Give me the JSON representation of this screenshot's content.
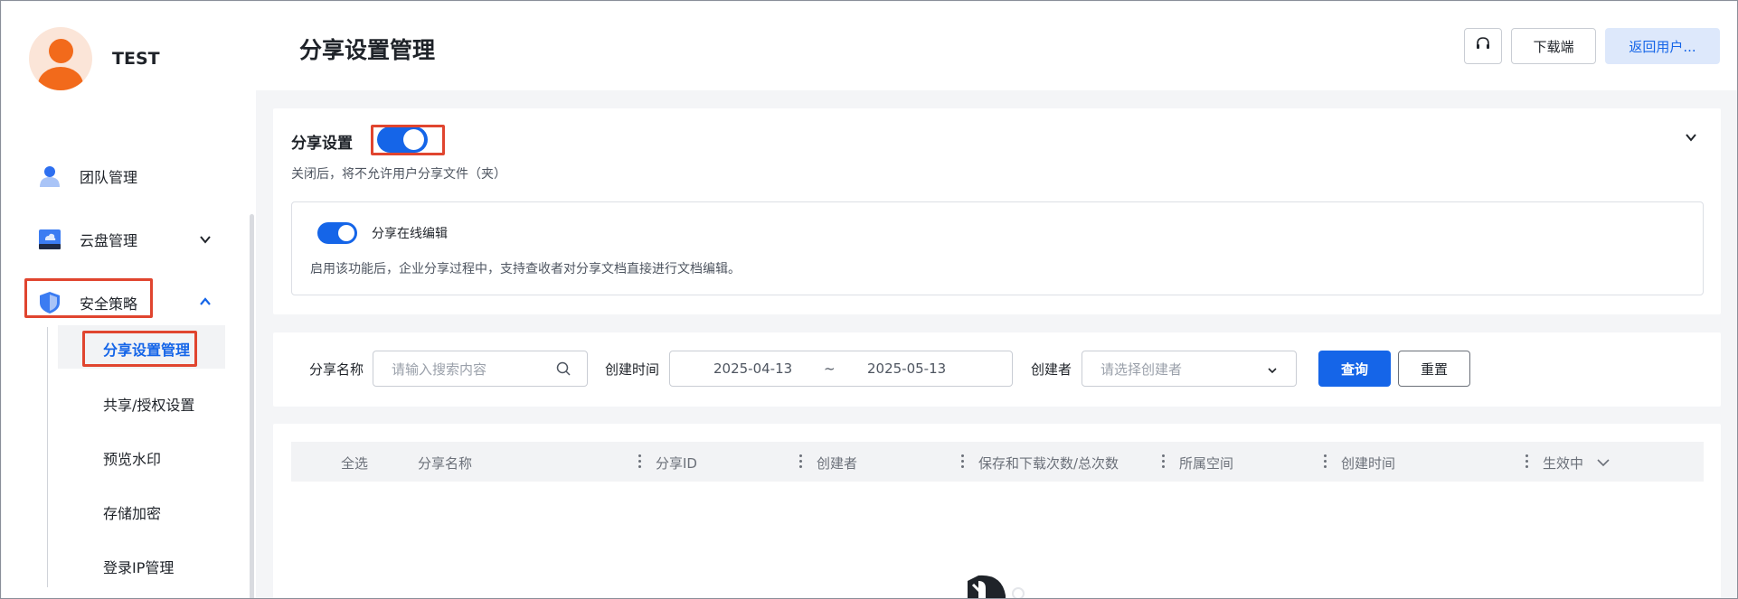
{
  "user": {
    "name": "TEST"
  },
  "sidebar": {
    "items": [
      {
        "label": "团队管理",
        "icon": "team-icon"
      },
      {
        "label": "云盘管理",
        "icon": "cloud-drive-icon",
        "expanded": false
      },
      {
        "label": "安全策略",
        "icon": "shield-icon",
        "expanded": true
      }
    ],
    "sub_items": [
      {
        "label": "分享设置管理",
        "active": true
      },
      {
        "label": "共享/授权设置",
        "active": false
      },
      {
        "label": "预览水印",
        "active": false
      },
      {
        "label": "存储加密",
        "active": false
      },
      {
        "label": "登录IP管理",
        "active": false
      }
    ]
  },
  "header": {
    "title": "分享设置管理",
    "support_icon": "headset-icon",
    "download_label": "下载端",
    "return_label": "返回用户..."
  },
  "share_settings": {
    "title": "分享设置",
    "enabled": true,
    "description": "关闭后，将不允许用户分享文件（夹）",
    "online_edit": {
      "label": "分享在线编辑",
      "enabled": true,
      "description": "启用该功能后，企业分享过程中，支持查收者对分享文档直接进行文档编辑。"
    }
  },
  "filters": {
    "name_label": "分享名称",
    "name_placeholder": "请输入搜索内容",
    "time_label": "创建时间",
    "start_date": "2025-04-13",
    "date_separator": "~",
    "end_date": "2025-05-13",
    "creator_label": "创建者",
    "creator_placeholder": "请选择创建者",
    "query_label": "查询",
    "reset_label": "重置"
  },
  "table": {
    "columns": [
      "全选",
      "分享名称",
      "分享ID",
      "创建者",
      "保存和下载次数/总次数",
      "所属空间",
      "创建时间",
      "生效中"
    ]
  },
  "colors": {
    "accent": "#1565e8",
    "highlight": "#e0452f",
    "avatar": "#f26a1b"
  }
}
